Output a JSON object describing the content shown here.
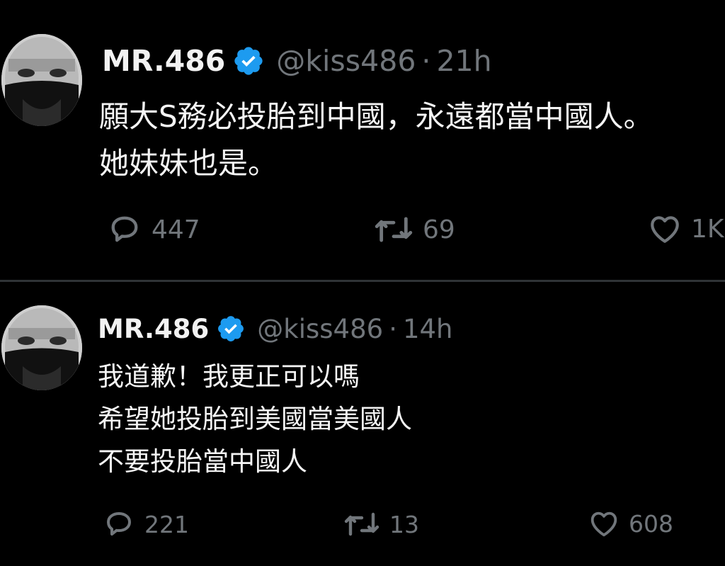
{
  "tweets": [
    {
      "name": "MR.486",
      "handle": "@kiss486",
      "separator": "·",
      "time": "21h",
      "lines": [
        "願大S務必投胎到中國，永遠都當中國人。",
        "她妹妹也是。"
      ],
      "replies": "447",
      "retweets": "69",
      "likes": "1K"
    },
    {
      "name": "MR.486",
      "handle": "@kiss486",
      "separator": "·",
      "time": "14h",
      "lines": [
        "我道歉！我更正可以嗎",
        "希望她投胎到美國當美國人",
        "不要投胎當中國人"
      ],
      "replies": "221",
      "retweets": "13",
      "likes": "608"
    }
  ],
  "icons": {
    "reply": "reply-icon",
    "retweet": "retweet-icon",
    "like": "heart-icon",
    "verified": "verified-badge-icon"
  },
  "colors": {
    "background": "#000000",
    "verified": "#1d9bf0",
    "muted": "#71767b",
    "text": "#e7e9ea"
  }
}
